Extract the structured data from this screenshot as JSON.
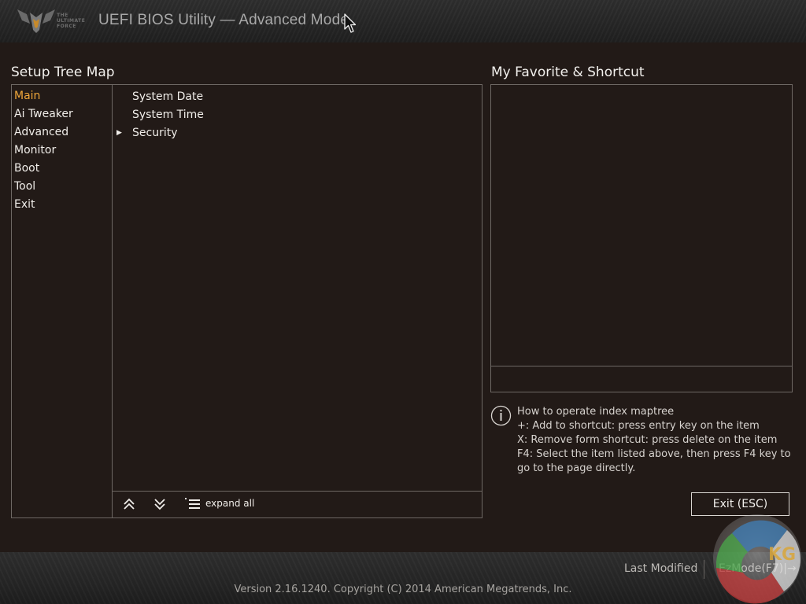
{
  "header": {
    "logo_text_lines": [
      "THE",
      "ULTIMATE",
      "FORCE"
    ],
    "title": "UEFI BIOS Utility — Advanced Mode"
  },
  "tree_map": {
    "title": "Setup Tree Map",
    "menu": [
      {
        "label": "Main",
        "active": true
      },
      {
        "label": "Ai Tweaker"
      },
      {
        "label": "Advanced"
      },
      {
        "label": "Monitor"
      },
      {
        "label": "Boot"
      },
      {
        "label": "Tool"
      },
      {
        "label": "Exit"
      }
    ],
    "items": [
      {
        "label": "System Date"
      },
      {
        "label": "System Time"
      },
      {
        "label": "Security",
        "expandable": true,
        "arrow": "▶"
      }
    ],
    "footer": {
      "collapse_icon": "double-chevron-up-icon",
      "expand_icon": "double-chevron-down-icon",
      "expand_all_icon": "list-icon",
      "expand_all_label": "expand all"
    }
  },
  "favorites": {
    "title": "My Favorite & Shortcut",
    "help_icon": "info-icon",
    "help_lines": [
      "How to operate index maptree",
      "+: Add to shortcut: press entry key on the item",
      "X: Remove form shortcut: press delete on the item",
      "F4: Select the item listed above, then press F4 key to",
      "go to the page directly."
    ],
    "exit_label": "Exit (ESC)"
  },
  "bottom_bar": {
    "last_modified": "Last Modified",
    "ezmode": "EzMode(F7)|→",
    "version": "Version 2.16.1240. Copyright (C) 2014 American Megatrends, Inc."
  },
  "watermark": {
    "text": "KG"
  },
  "colors": {
    "background": "#221a17",
    "accent_active": "#f0a73a",
    "border": "#6e6864",
    "text": "#f0ede9"
  }
}
